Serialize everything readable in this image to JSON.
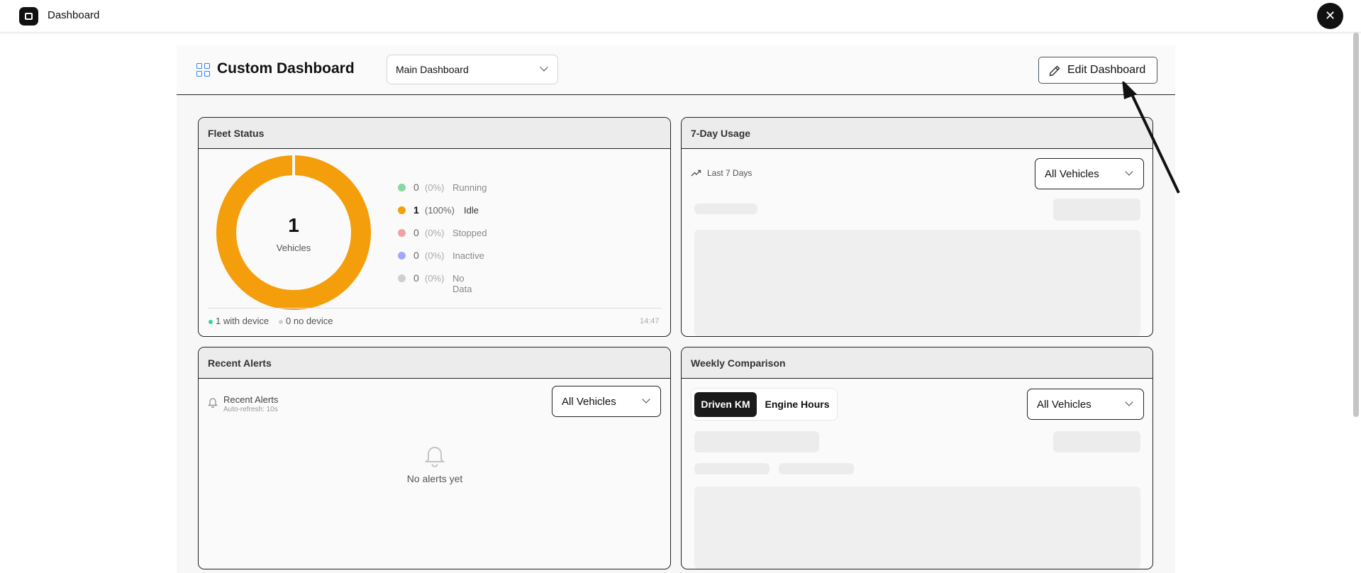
{
  "topbar": {
    "title": "Dashboard",
    "close_label": "✕"
  },
  "header": {
    "title": "Custom Dashboard",
    "dashboard_select": {
      "value": "Main Dashboard"
    },
    "edit_label": "Edit Dashboard"
  },
  "fleet": {
    "title": "Fleet Status",
    "total": "1",
    "total_label": "Vehicles",
    "donut_color": "#f59e0b",
    "rows": [
      {
        "count": "0",
        "pct": "(0%)",
        "label": "Running",
        "color": "#86d9a0"
      },
      {
        "count": "1",
        "pct": "(100%)",
        "label": "Idle",
        "color": "#f59e0b"
      },
      {
        "count": "0",
        "pct": "(0%)",
        "label": "Stopped",
        "color": "#f2a1a1"
      },
      {
        "count": "0",
        "pct": "(0%)",
        "label": "Inactive",
        "color": "#a5a8f5"
      },
      {
        "count": "0",
        "pct": "(0%)",
        "label": "No Data",
        "color": "#cfcfcf"
      }
    ],
    "with_device": "1 with device",
    "no_device": "0 no device",
    "time": "14:47"
  },
  "usage": {
    "title": "7-Day Usage",
    "period": "Last 7 Days",
    "vehicle_select": "All Vehicles"
  },
  "alerts": {
    "title": "Recent Alerts",
    "inner_title": "Recent Alerts",
    "refresh": "Auto-refresh: 10s",
    "vehicle_select": "All Vehicles",
    "empty": "No alerts yet"
  },
  "weekly": {
    "title": "Weekly Comparison",
    "tabs": [
      "Driven KM",
      "Engine Hours"
    ],
    "vehicle_select": "All Vehicles"
  }
}
